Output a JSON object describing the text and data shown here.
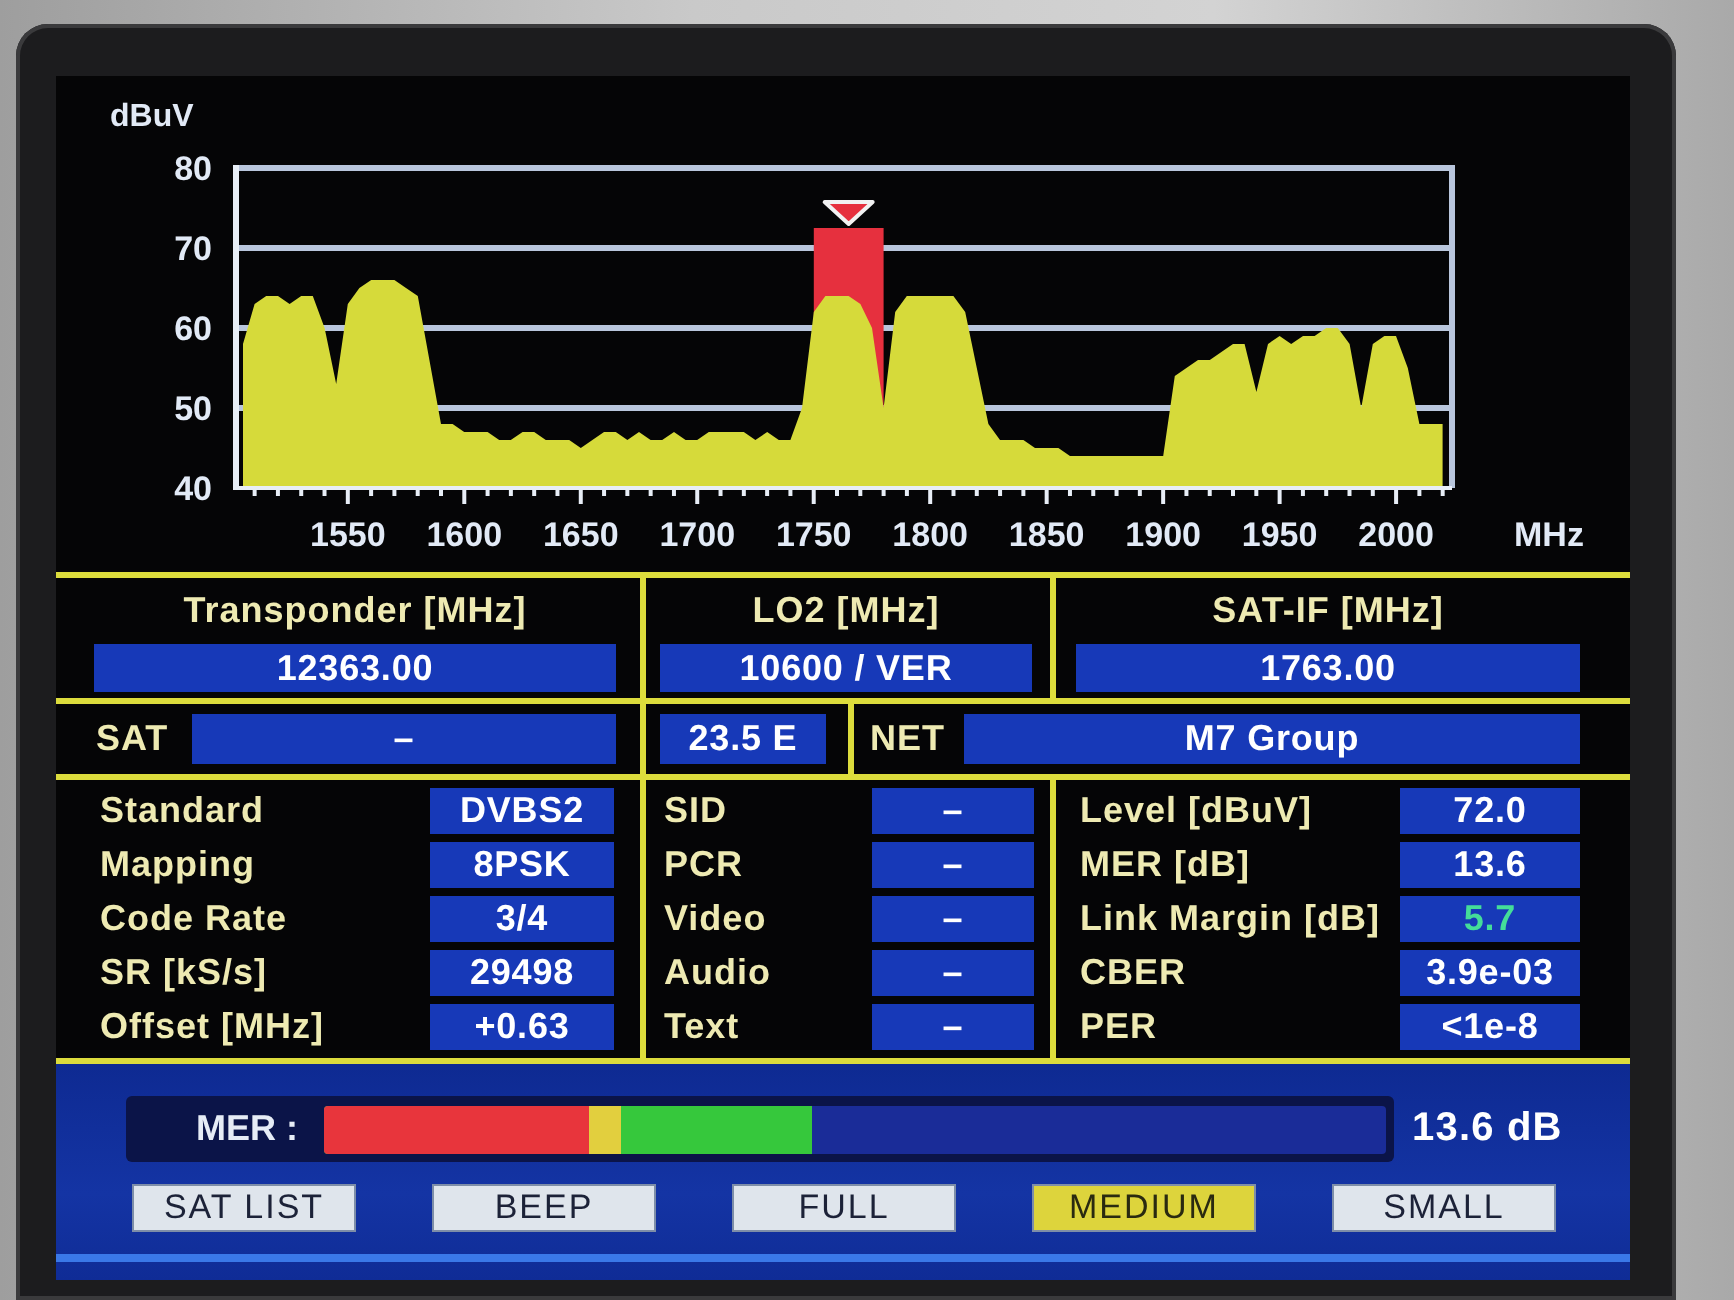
{
  "spectrum": {
    "chart_data": {
      "type": "area",
      "xlabel": "MHz",
      "ylabel": "dBuV",
      "x": [
        1505,
        1510,
        1515,
        1520,
        1525,
        1530,
        1535,
        1540,
        1545,
        1550,
        1555,
        1560,
        1565,
        1570,
        1575,
        1580,
        1585,
        1590,
        1595,
        1600,
        1605,
        1610,
        1615,
        1620,
        1625,
        1630,
        1635,
        1640,
        1645,
        1650,
        1655,
        1660,
        1665,
        1670,
        1675,
        1680,
        1685,
        1690,
        1695,
        1700,
        1705,
        1710,
        1715,
        1720,
        1725,
        1730,
        1735,
        1740,
        1745,
        1750,
        1755,
        1760,
        1765,
        1770,
        1775,
        1780,
        1785,
        1790,
        1795,
        1800,
        1805,
        1810,
        1815,
        1820,
        1825,
        1830,
        1835,
        1840,
        1845,
        1850,
        1855,
        1860,
        1865,
        1870,
        1875,
        1880,
        1885,
        1890,
        1895,
        1900,
        1905,
        1910,
        1915,
        1920,
        1925,
        1930,
        1935,
        1940,
        1945,
        1950,
        1955,
        1960,
        1965,
        1970,
        1975,
        1980,
        1985,
        1990,
        1995,
        2000,
        2005,
        2010,
        2015,
        2020
      ],
      "series": [
        {
          "color": "#e6303e",
          "values": [
            null,
            null,
            null,
            null,
            null,
            null,
            null,
            null,
            null,
            null,
            null,
            null,
            null,
            null,
            null,
            null,
            null,
            null,
            null,
            null,
            null,
            null,
            null,
            null,
            null,
            null,
            null,
            null,
            null,
            null,
            null,
            null,
            null,
            null,
            null,
            null,
            null,
            null,
            null,
            null,
            null,
            null,
            null,
            null,
            null,
            null,
            null,
            null,
            null,
            72.5,
            72.5,
            72.5,
            72.5,
            72.5,
            72.5,
            72.5,
            null,
            null,
            null,
            null,
            null,
            null,
            null,
            null,
            null,
            null,
            null,
            null,
            null,
            null,
            null,
            null,
            null,
            null,
            null,
            null,
            null,
            null,
            null,
            null,
            null,
            null,
            null,
            null,
            null,
            null,
            null,
            null,
            null,
            null,
            null,
            null,
            null,
            null,
            null,
            null,
            null,
            null,
            null,
            null,
            null,
            null,
            null,
            null
          ]
        },
        {
          "color": "#d6da3a",
          "values": [
            58,
            63,
            64,
            64,
            63,
            64,
            64,
            60,
            53,
            63,
            65,
            66,
            66,
            66,
            65,
            64,
            56,
            48,
            48,
            47,
            47,
            47,
            46,
            46,
            47,
            47,
            46,
            46,
            46,
            45,
            46,
            47,
            47,
            46,
            47,
            46,
            46,
            47,
            46,
            46,
            47,
            47,
            47,
            47,
            46,
            47,
            46,
            46,
            50,
            62,
            64,
            64,
            64,
            63,
            60,
            50,
            62,
            64,
            64,
            64,
            64,
            64,
            62,
            55,
            48,
            46,
            46,
            46,
            45,
            45,
            45,
            44,
            44,
            44,
            44,
            44,
            44,
            44,
            44,
            44,
            54,
            55,
            56,
            56,
            57,
            58,
            58,
            52,
            58,
            59,
            58,
            59,
            59,
            60,
            60,
            58,
            50,
            58,
            59,
            59,
            55,
            48,
            48,
            48
          ]
        }
      ],
      "xlim": [
        1502,
        2024
      ],
      "ylim": [
        40,
        80
      ],
      "xticks": [
        1550,
        1600,
        1650,
        1700,
        1750,
        1800,
        1850,
        1900,
        1950,
        2000
      ],
      "yticks": [
        40,
        50,
        60,
        70,
        80
      ],
      "grid": true
    }
  },
  "tuning": {
    "columns": [
      {
        "label": "Transponder [MHz]",
        "value": "12363.00"
      },
      {
        "label": "LO2 [MHz]",
        "value": "10600 / VER"
      },
      {
        "label": "SAT-IF [MHz]",
        "value": "1763.00"
      }
    ]
  },
  "satellite": {
    "label": "SAT",
    "value": "–",
    "position": "23.5 E"
  },
  "network": {
    "label": "NET",
    "value": "M7 Group"
  },
  "signal_info": {
    "modulation": [
      {
        "label": "Standard",
        "value": "DVBS2"
      },
      {
        "label": "Mapping",
        "value": "8PSK"
      },
      {
        "label": "Code Rate",
        "value": "3/4"
      },
      {
        "label": "SR [kS/s]",
        "value": "29498"
      },
      {
        "label": "Offset [MHz]",
        "value": "+0.63"
      }
    ],
    "services": [
      {
        "label": "SID",
        "value": "–"
      },
      {
        "label": "PCR",
        "value": "–"
      },
      {
        "label": "Video",
        "value": "–"
      },
      {
        "label": "Audio",
        "value": "–"
      },
      {
        "label": "Text",
        "value": "–"
      }
    ],
    "measurements": [
      {
        "label": "Level [dBuV]",
        "value": "72.0",
        "highlighted": false
      },
      {
        "label": "MER [dB]",
        "value": "13.6",
        "highlighted": false
      },
      {
        "label": "Link Margin [dB]",
        "value": "5.7",
        "highlighted": true
      },
      {
        "label": "CBER",
        "value": "3.9e-03",
        "highlighted": false
      },
      {
        "label": "PER",
        "value": "<1e-8",
        "highlighted": false
      }
    ]
  },
  "mer_bar": {
    "label": "MER :",
    "level": 0.46,
    "reading": "13.6 dB"
  },
  "buttons": [
    {
      "label": "SAT LIST",
      "selected": false
    },
    {
      "label": "BEEP",
      "selected": false
    },
    {
      "label": "FULL",
      "selected": false
    },
    {
      "label": "MEDIUM",
      "selected": true
    },
    {
      "label": "SMALL",
      "selected": false
    }
  ]
}
